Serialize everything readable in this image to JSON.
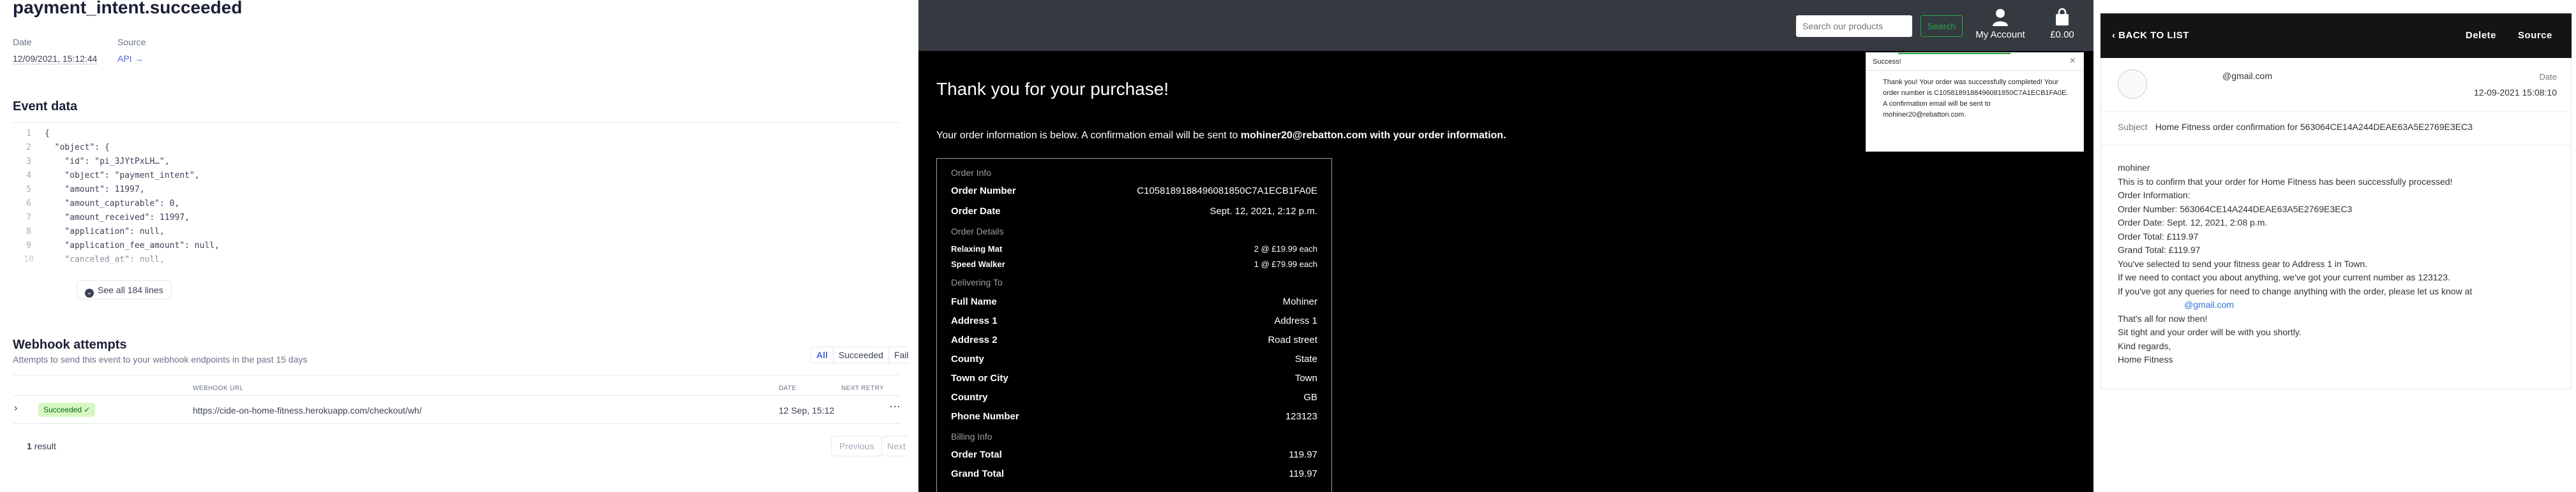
{
  "stripe": {
    "event_type": "payment_intent.succeeded",
    "date_label": "Date",
    "date_value": "12/09/2021, 15:12:44",
    "source_label": "Source",
    "source_value": "API →",
    "event_data_title": "Event data",
    "code_lines": [
      {
        "n": "1",
        "t": "{"
      },
      {
        "n": "2",
        "t": "  \"object\": {"
      },
      {
        "n": "3",
        "t": "    \"id\": \"pi_3JYtPxLH…\","
      },
      {
        "n": "4",
        "t": "    \"object\": \"payment_intent\","
      },
      {
        "n": "5",
        "t": "    \"amount\": 11997,"
      },
      {
        "n": "6",
        "t": "    \"amount_capturable\": 0,"
      },
      {
        "n": "7",
        "t": "    \"amount_received\": 11997,"
      },
      {
        "n": "8",
        "t": "    \"application\": null,"
      },
      {
        "n": "9",
        "t": "    \"application_fee_amount\": null,"
      },
      {
        "n": "10",
        "t": "    \"canceled_at\": null,"
      }
    ],
    "see_all_label": "See all 184 lines",
    "webhook_title": "Webhook attempts",
    "webhook_subtitle": "Attempts to send this event to your webhook endpoints in the past 15 days",
    "filters": [
      "All",
      "Succeeded",
      "Failed"
    ],
    "columns": {
      "url": "WEBHOOK URL",
      "date": "DATE",
      "retry": "NEXT RETRY"
    },
    "row": {
      "status": "Succeeded ✓",
      "url": "https://cide-on-home-fitness.herokuapp.com/checkout/wh/",
      "date": "12 Sep, 15:12"
    },
    "result_count": "1",
    "result_label": "result",
    "prev_label": "Previous",
    "next_label": "Next"
  },
  "shop": {
    "search_placeholder": "Search our products",
    "search_button": "Search",
    "account_label": "My Account",
    "bag_total": "£0.00",
    "thank_you": "Thank you for your purchase!",
    "info_prefix": "Your order information is below. A confirmation email will be sent to",
    "info_email": "mohiner20@rebatton.com",
    "info_suffix": "with your order information.",
    "order_info_label": "Order Info",
    "order_number_label": "Order Number",
    "order_number": "C1058189188496081850C7A1ECB1FA0E",
    "order_date_label": "Order Date",
    "order_date": "Sept. 12, 2021, 2:12 p.m.",
    "order_details_label": "Order Details",
    "items": [
      {
        "name": "Relaxing Mat",
        "qty": "2 @ £19.99 each"
      },
      {
        "name": "Speed Walker",
        "qty": "1 @ £79.99 each"
      }
    ],
    "delivering_label": "Delivering To",
    "delivery": [
      {
        "k": "Full Name",
        "v": "Mohiner"
      },
      {
        "k": "Address 1",
        "v": "Address 1"
      },
      {
        "k": "Address 2",
        "v": "Road street"
      },
      {
        "k": "County",
        "v": "State"
      },
      {
        "k": "Town or City",
        "v": "Town"
      },
      {
        "k": "Country",
        "v": "GB"
      },
      {
        "k": "Phone Number",
        "v": "123123"
      }
    ],
    "billing_label": "Billing Info",
    "order_total_label": "Order Total",
    "order_total": "119.97",
    "grand_total_label": "Grand Total",
    "grand_total": "119.97",
    "toast": {
      "title": "Success!",
      "close": "×",
      "lines": [
        "Thank you! Your order was successfully completed! Your",
        "order number is C1058189188496081850C7A1ECB1FA0E.",
        "A confirmation email will be sent to",
        "mohiner20@rebatton.com."
      ]
    }
  },
  "email": {
    "back_label": "‹  BACK TO LIST",
    "delete_label": "Delete",
    "source_label": "Source",
    "from": "@gmail.com",
    "date_label": "Date",
    "date_value": "12-09-2021 15:08:10",
    "subject_label": "Subject",
    "subject": "Home Fitness order confirmation for 563064CE14A244DEAE63A5E2769E3EC3",
    "body_lines": [
      "mohiner",
      "This is to confirm that your order for Home Fitness has been successfully processed!",
      "Order Information:",
      "Order Number: 563064CE14A244DEAE63A5E2769E3EC3",
      "Order Date: Sept. 12, 2021, 2:08 p.m.",
      "Order Total: £119.97",
      "Grand Total: £119.97",
      "You've selected to send your fitness gear to Address 1 in Town.",
      "If we need to contact you about anything, we've got your current number as 123123.",
      "If you've got any queries for need to change anything with the order, please let us know at",
      "@gmail.com",
      "That's all for now then!",
      "Sit tight and your order will be with you shortly.",
      "Kind regards,",
      "Home Fitness"
    ]
  }
}
